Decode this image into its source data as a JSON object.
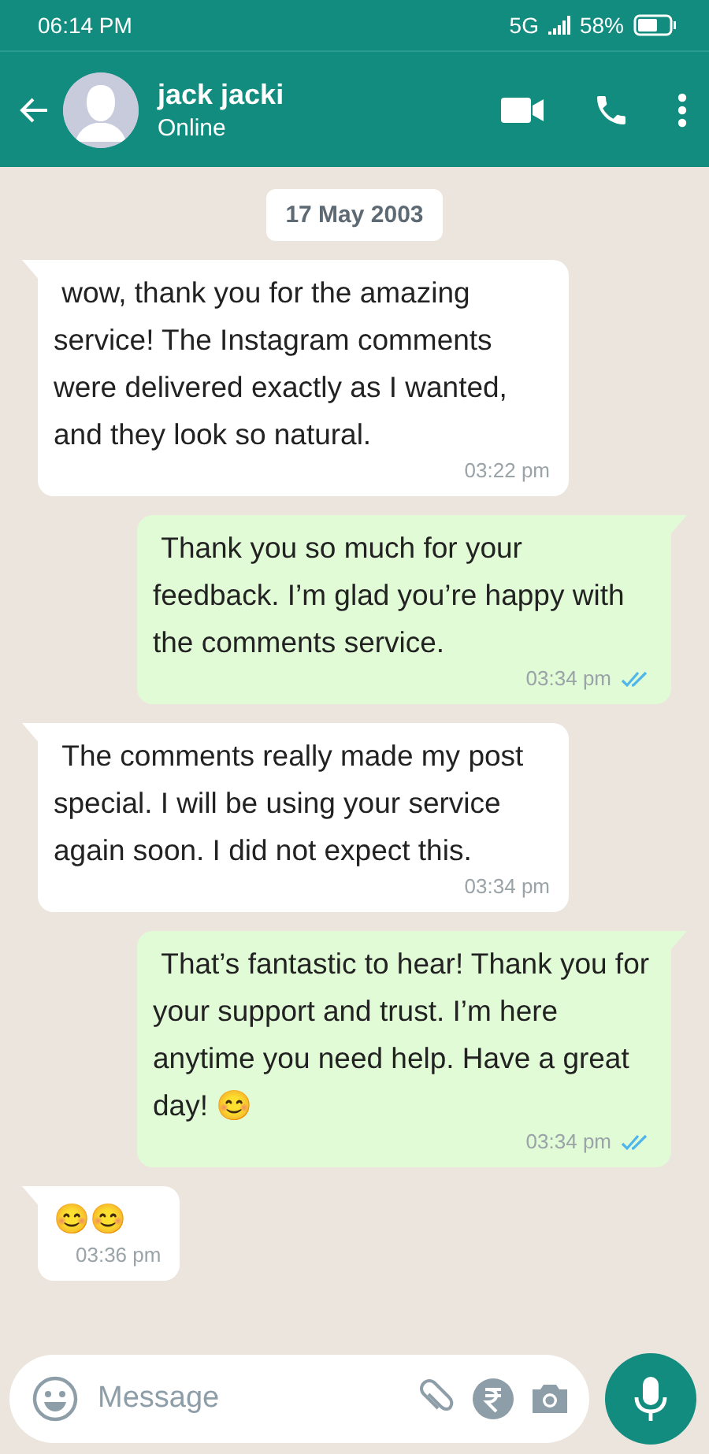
{
  "status_bar": {
    "time": "06:14 PM",
    "network": "5G",
    "battery": "58%"
  },
  "header": {
    "name": "jack jacki",
    "status": "Online"
  },
  "date_chip": "17 May 2003",
  "messages": [
    {
      "kind": "incoming",
      "text": " wow, thank you for the amazing service! The Instagram comments were delivered exactly as I wanted, and they look so natural.",
      "time": "03:22 pm"
    },
    {
      "kind": "outgoing",
      "text": " Thank you so much for your feedback. I’m glad you’re happy with the comments service.",
      "time": "03:34 pm",
      "read": true
    },
    {
      "kind": "incoming",
      "text": " The comments really made my post special. I will be using your service again soon. I did not expect this.",
      "time": "03:34 pm"
    },
    {
      "kind": "outgoing",
      "text": " That’s fantastic to hear! Thank you for your support and trust. I’m here anytime you need help. Have a great day! 😊",
      "time": "03:34 pm",
      "read": true
    },
    {
      "kind": "incoming",
      "text": "😊😊",
      "time": "03:36 pm"
    }
  ],
  "composer": {
    "placeholder": "Message"
  }
}
